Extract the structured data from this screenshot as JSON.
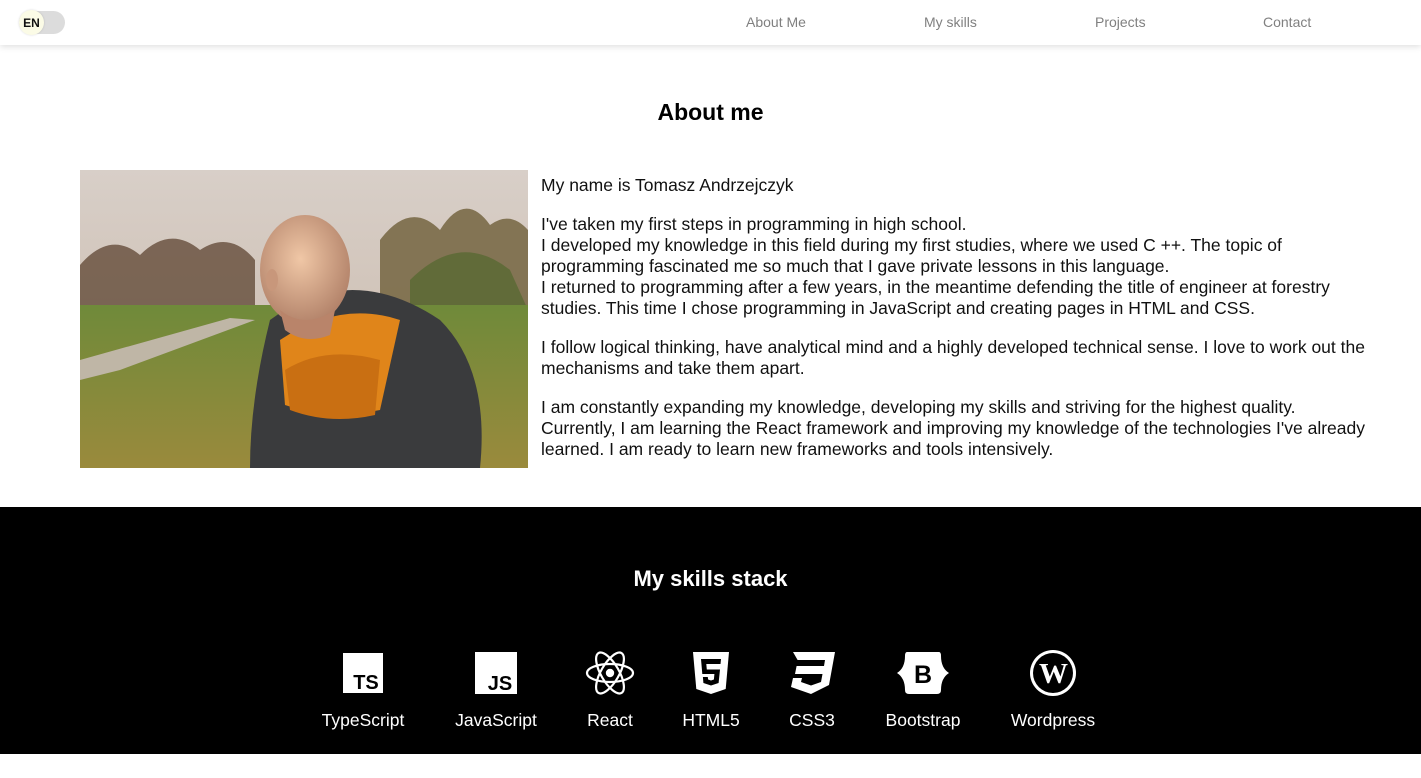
{
  "header": {
    "lang_toggle": {
      "label": "EN"
    },
    "nav": [
      {
        "label": "About Me"
      },
      {
        "label": "My skills"
      },
      {
        "label": "Projects"
      },
      {
        "label": "Contact"
      }
    ]
  },
  "about": {
    "title": "About me",
    "paragraphs": [
      "My name is Tomasz Andrzejczyk",
      "I've taken my first steps in programming in high school.",
      "I developed my knowledge in this field during my first studies, where we used C ++. The topic of programming fascinated me so much that I gave private lessons in this language.",
      "I returned to programming after a few years, in the meantime defending the title of engineer at forestry studies. This time I chose programming in JavaScript and creating pages in HTML and CSS.",
      "I follow logical thinking, have analytical mind and a highly developed technical sense. I love to work out the mechanisms and take them apart.",
      "I am constantly expanding my knowledge, developing my skills and striving for the highest quality. Currently, I am learning the React framework and improving my knowledge of the technologies I've already learned. I am ready to learn new frameworks and tools intensively."
    ]
  },
  "skills": {
    "title": "My skills stack",
    "items": [
      {
        "label": "TypeScript",
        "icon": "typescript-icon"
      },
      {
        "label": "JavaScript",
        "icon": "javascript-icon"
      },
      {
        "label": "React",
        "icon": "react-icon"
      },
      {
        "label": "HTML5",
        "icon": "html5-icon"
      },
      {
        "label": "CSS3",
        "icon": "css3-icon"
      },
      {
        "label": "Bootstrap",
        "icon": "bootstrap-icon"
      },
      {
        "label": "Wordpress",
        "icon": "wordpress-icon"
      }
    ]
  },
  "colors": {
    "skills_background": "#000000",
    "nav_text": "#808080",
    "toggle_track": "#dcdcdc",
    "toggle_knob": "#fbfbe6"
  }
}
